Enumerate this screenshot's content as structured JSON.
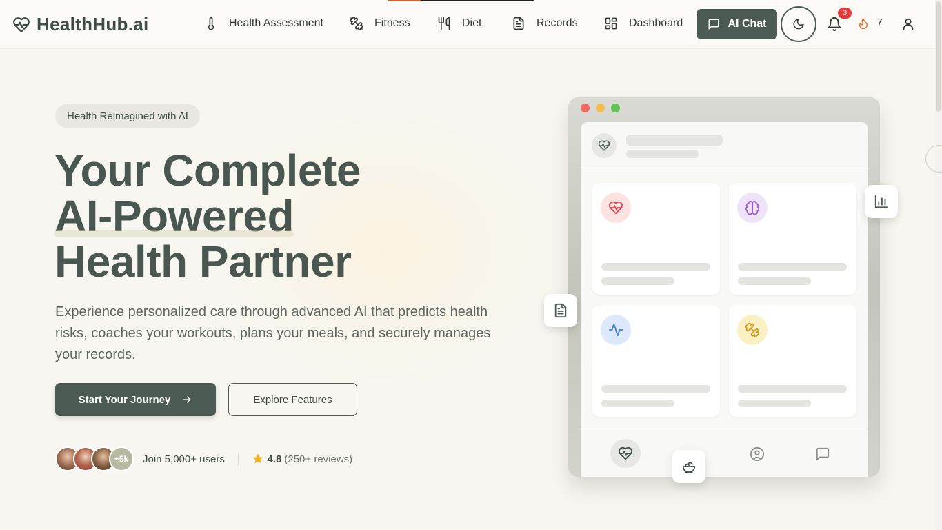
{
  "app": {
    "name": "HealthHub.ai"
  },
  "nav": {
    "items": [
      {
        "label": "Health Assessment",
        "icon": "thermometer-icon"
      },
      {
        "label": "Fitness",
        "icon": "dumbbell-icon"
      },
      {
        "label": "Diet",
        "icon": "utensils-icon"
      },
      {
        "label": "Records",
        "icon": "document-icon"
      },
      {
        "label": "Dashboard",
        "icon": "grid-icon"
      }
    ],
    "ai_chat_label": "AI Chat",
    "notifications_count": "3",
    "streak_count": "7"
  },
  "hero": {
    "badge": "Health Reimagined with AI",
    "headline_line1": "Your Complete",
    "headline_line2": "AI-Powered",
    "headline_line3": "Health Partner",
    "description": "Experience personalized care through advanced AI that predicts health risks, coaches your workouts, plans your meals, and securely manages your records.",
    "primary_cta": "Start Your Journey",
    "secondary_cta": "Explore Features"
  },
  "social_proof": {
    "more_avatars": "+5k",
    "join_text": "Join 5,000+ users",
    "rating": "4.8",
    "reviews": "(250+ reviews)"
  },
  "colors": {
    "accent": "#4b5a53",
    "background": "#f7f6f0",
    "badge_red": "#e23b3b"
  }
}
